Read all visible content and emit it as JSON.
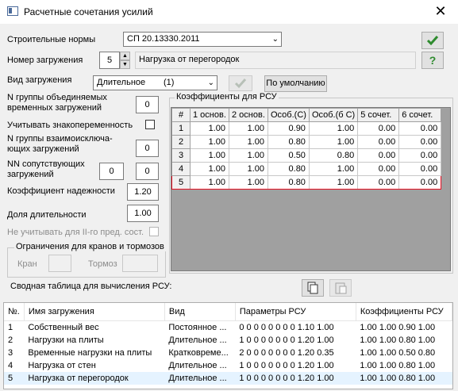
{
  "window": {
    "title": "Расчетные сочетания усилий",
    "close_glyph": "✕"
  },
  "norms": {
    "label": "Строительные нормы",
    "value": "СП 20.13330.2011"
  },
  "load_number": {
    "label": "Номер загружения",
    "value": "5",
    "name": "Нагрузка от перегородок"
  },
  "load_type": {
    "label": "Вид загружения",
    "value": "Длительное",
    "code": "(1)",
    "default_button": "По умолчанию"
  },
  "combined_group": {
    "label_line1": "N группы объединяемых",
    "label_line2": "временных загружений",
    "value": "0"
  },
  "sign_variable": {
    "label": "Учитывать знакопеременность",
    "checked": false
  },
  "mutex_group": {
    "label_line1": "N группы взаимоисключа-",
    "label_line2": "ющих загружений",
    "value": "0"
  },
  "accompanying": {
    "label_line1": "NN сопутствующих",
    "label_line2": "загружений",
    "value1": "0",
    "value2": "0"
  },
  "reliability": {
    "label": "Коэффициент надежности",
    "value": "1.20"
  },
  "duration_share": {
    "label": "Доля длительности",
    "value": "1.00"
  },
  "ignore_second": {
    "label": "Не учитывать для II-го пред. сост.",
    "checked": false
  },
  "crane_limits": {
    "legend": "Ограничения для кранов и тормозов",
    "crane_label": "Кран",
    "brake_label": "Тормоз"
  },
  "rsu_coeffs": {
    "legend": "Коэффициенты для РСУ",
    "columns": [
      "#",
      "1 основ.",
      "2 основ.",
      "Особ.(С)",
      "Особ.(б С)",
      "5 сочет.",
      "6 сочет."
    ],
    "rows": [
      [
        "1",
        "1.00",
        "1.00",
        "0.90",
        "1.00",
        "0.00",
        "0.00"
      ],
      [
        "2",
        "1.00",
        "1.00",
        "0.80",
        "1.00",
        "0.00",
        "0.00"
      ],
      [
        "3",
        "1.00",
        "1.00",
        "0.50",
        "0.80",
        "0.00",
        "0.00"
      ],
      [
        "4",
        "1.00",
        "1.00",
        "0.80",
        "1.00",
        "0.00",
        "0.00"
      ],
      [
        "5",
        "1.00",
        "1.00",
        "0.80",
        "1.00",
        "0.00",
        "0.00"
      ]
    ],
    "selected_row": 4
  },
  "summary": {
    "label": "Сводная таблица для вычисления РСУ:",
    "columns": [
      "№.",
      "Имя загружения",
      "Вид",
      "Параметры РСУ",
      "Коэффициенты РСУ"
    ],
    "rows": [
      [
        "1",
        "Собственный вес",
        "Постоянное ...",
        "0 0 0 0 0 0 0 0 1.10 1.00",
        "1.00 1.00 0.90 1.00"
      ],
      [
        "2",
        "Нагрузки на плиты",
        "Длительное ...",
        "1 0 0 0 0 0 0 0 1.20 1.00",
        "1.00 1.00 0.80 1.00"
      ],
      [
        "3",
        "Временные нагрузки на плиты",
        "Кратковреме...",
        "2 0 0 0 0 0 0 0 1.20 0.35",
        "1.00 1.00 0.50 0.80"
      ],
      [
        "4",
        "Нагрузка от стен",
        "Длительное ...",
        "1 0 0 0 0 0 0 0 1.20 1.00",
        "1.00 1.00 0.80 1.00"
      ],
      [
        "5",
        "Нагрузка от перегородок",
        "Длительное ...",
        "1 0 0 0 0 0 0 0 1.20 1.00",
        "1.00 1.00 0.80 1.00"
      ]
    ],
    "selected_row": 4
  },
  "colors": {
    "ok_green": "#2e8b2e",
    "selection_red": "#e81123",
    "row_highlight": "#e5f3ff"
  }
}
